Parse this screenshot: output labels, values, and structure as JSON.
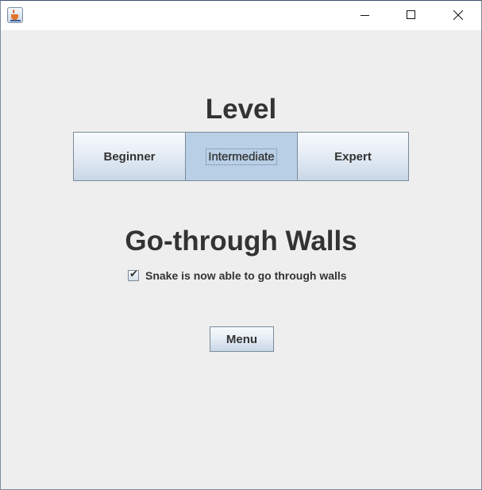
{
  "window": {
    "title": "",
    "controls": {
      "minimize_icon": "minimize-icon",
      "maximize_icon": "maximize-icon",
      "close_icon": "close-icon"
    }
  },
  "level": {
    "title": "Level",
    "options": [
      {
        "label": "Beginner",
        "selected": false
      },
      {
        "label": "Intermediate",
        "selected": true
      },
      {
        "label": "Expert",
        "selected": false
      }
    ]
  },
  "walls": {
    "title": "Go-through Walls",
    "checkbox_checked": true,
    "checkbox_mark": "✔",
    "checkbox_label": "Snake is now able to go through walls"
  },
  "menu": {
    "label": "Menu"
  },
  "colors": {
    "background": "#eeeeee",
    "selected_button": "#b8cfe5",
    "text": "#333333"
  }
}
